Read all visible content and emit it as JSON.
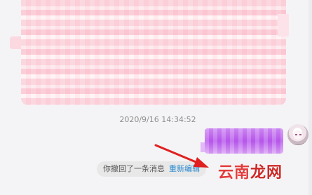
{
  "chat": {
    "timestamp": "2020/9/16 14:34:52",
    "recall_notice": {
      "text": "你撤回了一条消息",
      "action_label": "重新编辑"
    }
  },
  "watermark": {
    "part1": "云南",
    "part2": "龙网"
  },
  "colors": {
    "background": "#f4f4f6",
    "pink_bubble": "#fbd3dc",
    "purple_bubble": "#b858ec",
    "link_blue": "#2a8bd0",
    "arrow_red": "#e02020",
    "watermark_red": "#e23c3c"
  },
  "icons": {
    "avatar": "user-avatar-icon",
    "arrow": "red-pointer-arrow-icon"
  }
}
